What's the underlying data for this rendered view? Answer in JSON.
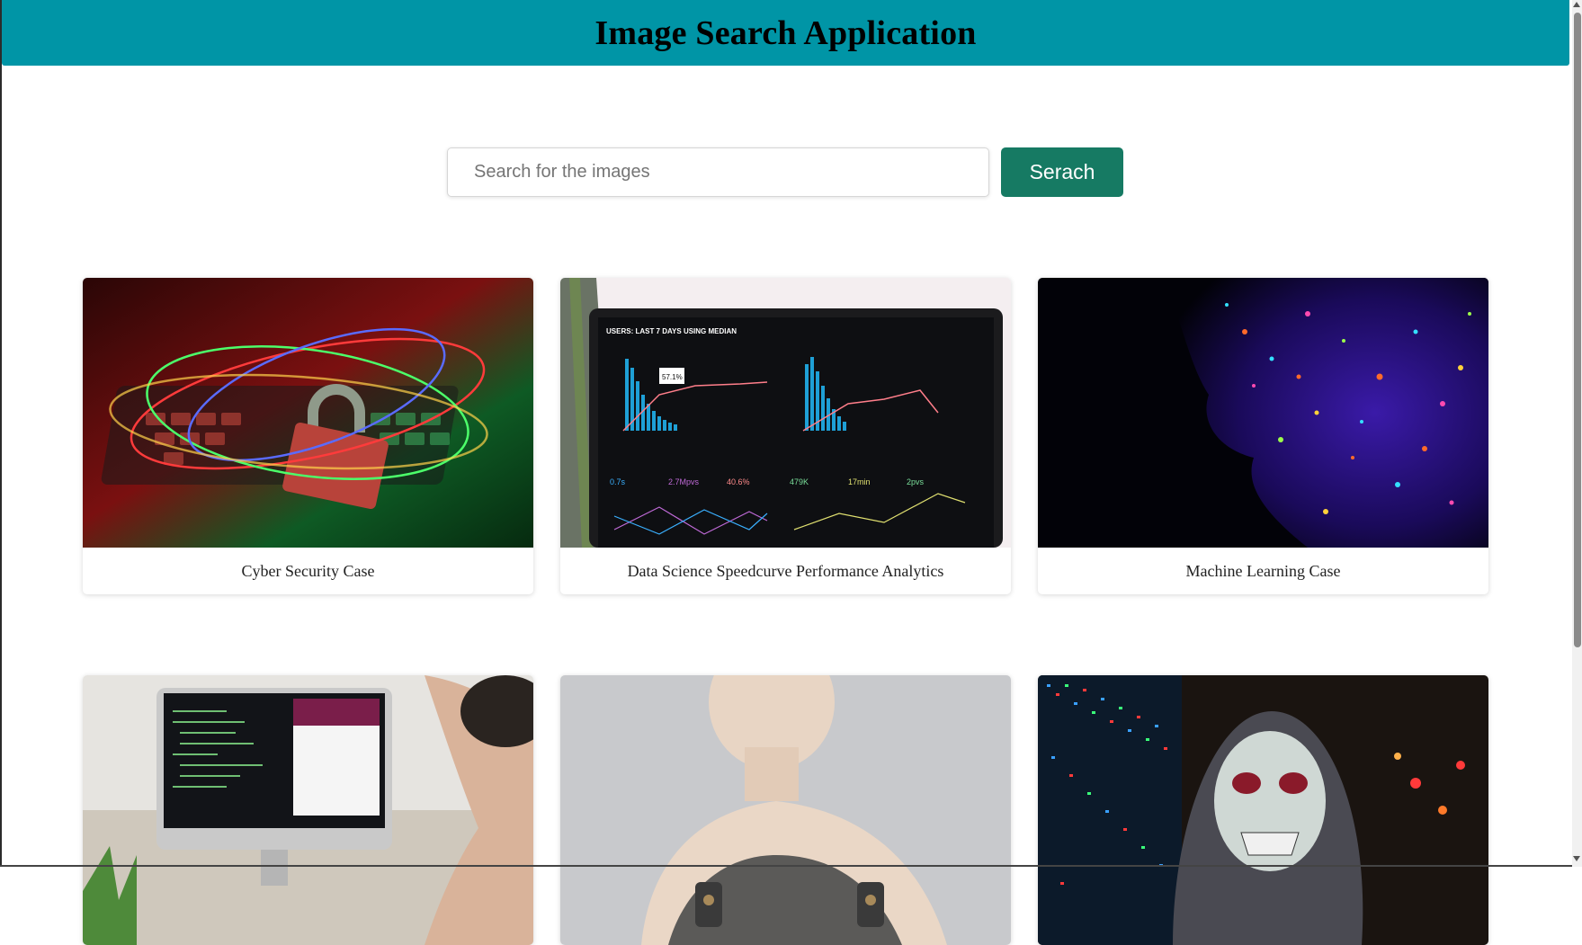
{
  "header": {
    "title": "Image Search Application"
  },
  "search": {
    "placeholder": "Search for the images",
    "value": "",
    "button_label": "Serach"
  },
  "results": [
    {
      "caption": "Cyber Security Case",
      "image": "padlock on laptop keyboard with light trails"
    },
    {
      "caption": "Data Science Speedcurve Performance Analytics",
      "image": "monitor showing analytics dashboard"
    },
    {
      "caption": "Machine Learning Case",
      "image": "face with glowing neon paint speckles"
    },
    {
      "caption": "",
      "image": "person looking at code on computer screen"
    },
    {
      "caption": "",
      "image": "humanoid robot"
    },
    {
      "caption": "",
      "image": "person in skull mask and hood with digital lights"
    }
  ],
  "colors": {
    "header_bg": "#0095a6",
    "button_bg": "#167a63",
    "button_text": "#ffffff"
  },
  "icons": [
    "scroll-up-arrow-icon",
    "scroll-down-arrow-icon"
  ]
}
